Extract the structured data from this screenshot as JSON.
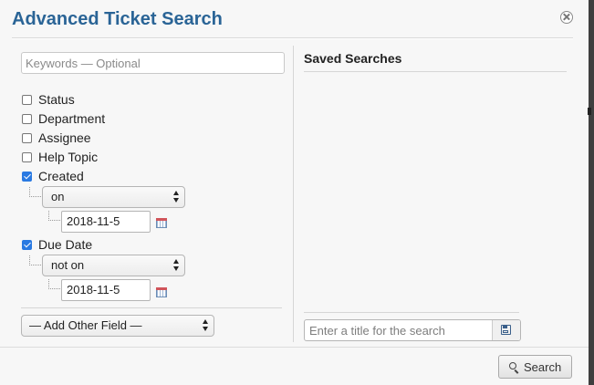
{
  "dialog": {
    "title": "Advanced Ticket Search"
  },
  "keywords": {
    "placeholder": "Keywords — Optional",
    "value": ""
  },
  "fields": [
    {
      "label": "Status",
      "checked": false
    },
    {
      "label": "Department",
      "checked": false
    },
    {
      "label": "Assignee",
      "checked": false
    },
    {
      "label": "Help Topic",
      "checked": false
    },
    {
      "label": "Created",
      "checked": true
    },
    {
      "label": "Due Date",
      "checked": true
    }
  ],
  "created": {
    "operator": "on",
    "date": "2018-11-5"
  },
  "due_date": {
    "operator": "not on",
    "date": "2018-11-5"
  },
  "add_field": {
    "label": "— Add Other Field —"
  },
  "saved": {
    "title": "Saved Searches",
    "items": [],
    "title_placeholder": "Enter a title for the search"
  },
  "search_button": {
    "label": "Search"
  },
  "icons": [
    "close-icon",
    "calendar-icon",
    "save-icon",
    "search-icon"
  ],
  "colors": {
    "title": "#2a6496",
    "checkbox_checked": "#2a7ae2"
  }
}
